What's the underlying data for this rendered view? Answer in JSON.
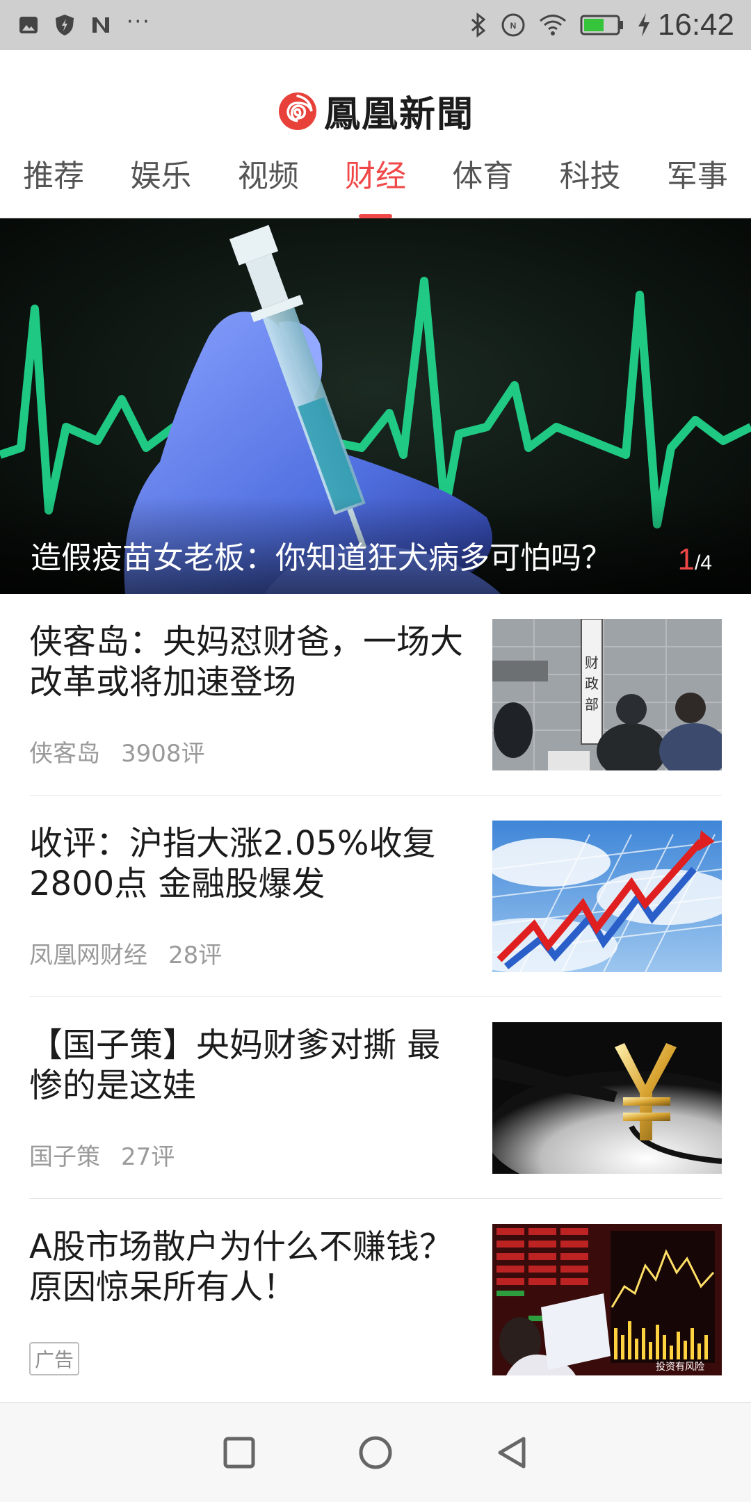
{
  "status_bar": {
    "time": "16:42",
    "left_icons": [
      "image-icon",
      "shield-icon",
      "n-icon",
      "more-icon"
    ],
    "more_text": "···",
    "right_icons": [
      "bluetooth-icon",
      "nfc-icon",
      "wifi-icon",
      "battery-icon",
      "charging-icon"
    ],
    "battery_level": 0.6
  },
  "header": {
    "title": "鳳凰新聞",
    "logo": "phoenix-logo-icon",
    "accent_color": "#f04848"
  },
  "tabs": [
    {
      "label": "推荐",
      "active": false
    },
    {
      "label": "娱乐",
      "active": false
    },
    {
      "label": "视频",
      "active": false
    },
    {
      "label": "财经",
      "active": true
    },
    {
      "label": "体育",
      "active": false
    },
    {
      "label": "科技",
      "active": false
    },
    {
      "label": "军事",
      "active": false
    }
  ],
  "hero": {
    "caption": "造假疫苗女老板：你知道狂犬病多可怕吗？",
    "counter_current": "1",
    "counter_total": "/4",
    "image": "syringe-heartbeat-image"
  },
  "news": [
    {
      "title": "侠客岛：央妈怼财爸，一场大改革或将加速登场",
      "source": "侠客岛",
      "comments": "3908评",
      "image": "ministry-of-finance-photo",
      "sign_text": "财政部"
    },
    {
      "title": "收评：沪指大涨2.05%收复2800点 金融股爆发",
      "source": "凤凰网财经",
      "comments": "28评",
      "image": "rising-chart-arrow-photo"
    },
    {
      "title": "【国子策】央妈财爹对撕 最惨的是这娃",
      "source": "国子策",
      "comments": "27评",
      "image": "golden-yuan-symbol-photo"
    },
    {
      "title": "A股市场散户为什么不赚钱？原因惊呆所有人！",
      "ad_label": "广告",
      "image": "stock-market-screen-photo",
      "image_caption": "投资有风险"
    }
  ],
  "nav_bar": {
    "buttons": [
      "recent-apps-icon",
      "home-icon",
      "back-icon"
    ]
  }
}
